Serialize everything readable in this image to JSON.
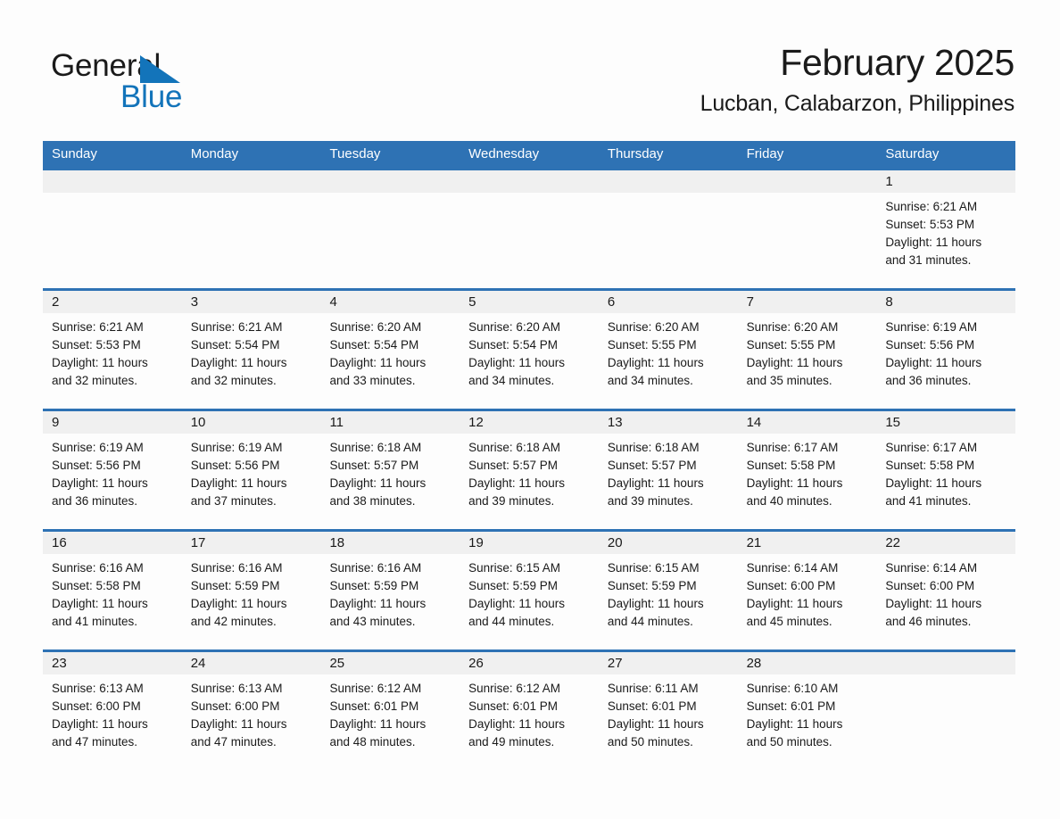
{
  "brand": {
    "name_dark": "General",
    "name_light": "Blue",
    "accent_color": "#1374ba"
  },
  "header": {
    "title": "February 2025",
    "subtitle": "Lucban, Calabarzon, Philippines"
  },
  "theme": {
    "header_blue": "#2e72b4",
    "band_gray": "#f0f0f0",
    "text_color": "#1a1a1a"
  },
  "weekdays": [
    "Sunday",
    "Monday",
    "Tuesday",
    "Wednesday",
    "Thursday",
    "Friday",
    "Saturday"
  ],
  "labels": {
    "sunrise_prefix": "Sunrise:",
    "sunset_prefix": "Sunset:",
    "daylight_prefix": "Daylight:"
  },
  "weeks": [
    [
      {
        "day": "",
        "lines": []
      },
      {
        "day": "",
        "lines": []
      },
      {
        "day": "",
        "lines": []
      },
      {
        "day": "",
        "lines": []
      },
      {
        "day": "",
        "lines": []
      },
      {
        "day": "",
        "lines": []
      },
      {
        "day": "1",
        "lines": [
          "Sunrise: 6:21 AM",
          "Sunset: 5:53 PM",
          "Daylight: 11 hours",
          "and 31 minutes."
        ]
      }
    ],
    [
      {
        "day": "2",
        "lines": [
          "Sunrise: 6:21 AM",
          "Sunset: 5:53 PM",
          "Daylight: 11 hours",
          "and 32 minutes."
        ]
      },
      {
        "day": "3",
        "lines": [
          "Sunrise: 6:21 AM",
          "Sunset: 5:54 PM",
          "Daylight: 11 hours",
          "and 32 minutes."
        ]
      },
      {
        "day": "4",
        "lines": [
          "Sunrise: 6:20 AM",
          "Sunset: 5:54 PM",
          "Daylight: 11 hours",
          "and 33 minutes."
        ]
      },
      {
        "day": "5",
        "lines": [
          "Sunrise: 6:20 AM",
          "Sunset: 5:54 PM",
          "Daylight: 11 hours",
          "and 34 minutes."
        ]
      },
      {
        "day": "6",
        "lines": [
          "Sunrise: 6:20 AM",
          "Sunset: 5:55 PM",
          "Daylight: 11 hours",
          "and 34 minutes."
        ]
      },
      {
        "day": "7",
        "lines": [
          "Sunrise: 6:20 AM",
          "Sunset: 5:55 PM",
          "Daylight: 11 hours",
          "and 35 minutes."
        ]
      },
      {
        "day": "8",
        "lines": [
          "Sunrise: 6:19 AM",
          "Sunset: 5:56 PM",
          "Daylight: 11 hours",
          "and 36 minutes."
        ]
      }
    ],
    [
      {
        "day": "9",
        "lines": [
          "Sunrise: 6:19 AM",
          "Sunset: 5:56 PM",
          "Daylight: 11 hours",
          "and 36 minutes."
        ]
      },
      {
        "day": "10",
        "lines": [
          "Sunrise: 6:19 AM",
          "Sunset: 5:56 PM",
          "Daylight: 11 hours",
          "and 37 minutes."
        ]
      },
      {
        "day": "11",
        "lines": [
          "Sunrise: 6:18 AM",
          "Sunset: 5:57 PM",
          "Daylight: 11 hours",
          "and 38 minutes."
        ]
      },
      {
        "day": "12",
        "lines": [
          "Sunrise: 6:18 AM",
          "Sunset: 5:57 PM",
          "Daylight: 11 hours",
          "and 39 minutes."
        ]
      },
      {
        "day": "13",
        "lines": [
          "Sunrise: 6:18 AM",
          "Sunset: 5:57 PM",
          "Daylight: 11 hours",
          "and 39 minutes."
        ]
      },
      {
        "day": "14",
        "lines": [
          "Sunrise: 6:17 AM",
          "Sunset: 5:58 PM",
          "Daylight: 11 hours",
          "and 40 minutes."
        ]
      },
      {
        "day": "15",
        "lines": [
          "Sunrise: 6:17 AM",
          "Sunset: 5:58 PM",
          "Daylight: 11 hours",
          "and 41 minutes."
        ]
      }
    ],
    [
      {
        "day": "16",
        "lines": [
          "Sunrise: 6:16 AM",
          "Sunset: 5:58 PM",
          "Daylight: 11 hours",
          "and 41 minutes."
        ]
      },
      {
        "day": "17",
        "lines": [
          "Sunrise: 6:16 AM",
          "Sunset: 5:59 PM",
          "Daylight: 11 hours",
          "and 42 minutes."
        ]
      },
      {
        "day": "18",
        "lines": [
          "Sunrise: 6:16 AM",
          "Sunset: 5:59 PM",
          "Daylight: 11 hours",
          "and 43 minutes."
        ]
      },
      {
        "day": "19",
        "lines": [
          "Sunrise: 6:15 AM",
          "Sunset: 5:59 PM",
          "Daylight: 11 hours",
          "and 44 minutes."
        ]
      },
      {
        "day": "20",
        "lines": [
          "Sunrise: 6:15 AM",
          "Sunset: 5:59 PM",
          "Daylight: 11 hours",
          "and 44 minutes."
        ]
      },
      {
        "day": "21",
        "lines": [
          "Sunrise: 6:14 AM",
          "Sunset: 6:00 PM",
          "Daylight: 11 hours",
          "and 45 minutes."
        ]
      },
      {
        "day": "22",
        "lines": [
          "Sunrise: 6:14 AM",
          "Sunset: 6:00 PM",
          "Daylight: 11 hours",
          "and 46 minutes."
        ]
      }
    ],
    [
      {
        "day": "23",
        "lines": [
          "Sunrise: 6:13 AM",
          "Sunset: 6:00 PM",
          "Daylight: 11 hours",
          "and 47 minutes."
        ]
      },
      {
        "day": "24",
        "lines": [
          "Sunrise: 6:13 AM",
          "Sunset: 6:00 PM",
          "Daylight: 11 hours",
          "and 47 minutes."
        ]
      },
      {
        "day": "25",
        "lines": [
          "Sunrise: 6:12 AM",
          "Sunset: 6:01 PM",
          "Daylight: 11 hours",
          "and 48 minutes."
        ]
      },
      {
        "day": "26",
        "lines": [
          "Sunrise: 6:12 AM",
          "Sunset: 6:01 PM",
          "Daylight: 11 hours",
          "and 49 minutes."
        ]
      },
      {
        "day": "27",
        "lines": [
          "Sunrise: 6:11 AM",
          "Sunset: 6:01 PM",
          "Daylight: 11 hours",
          "and 50 minutes."
        ]
      },
      {
        "day": "28",
        "lines": [
          "Sunrise: 6:10 AM",
          "Sunset: 6:01 PM",
          "Daylight: 11 hours",
          "and 50 minutes."
        ]
      },
      {
        "day": "",
        "lines": []
      }
    ]
  ]
}
